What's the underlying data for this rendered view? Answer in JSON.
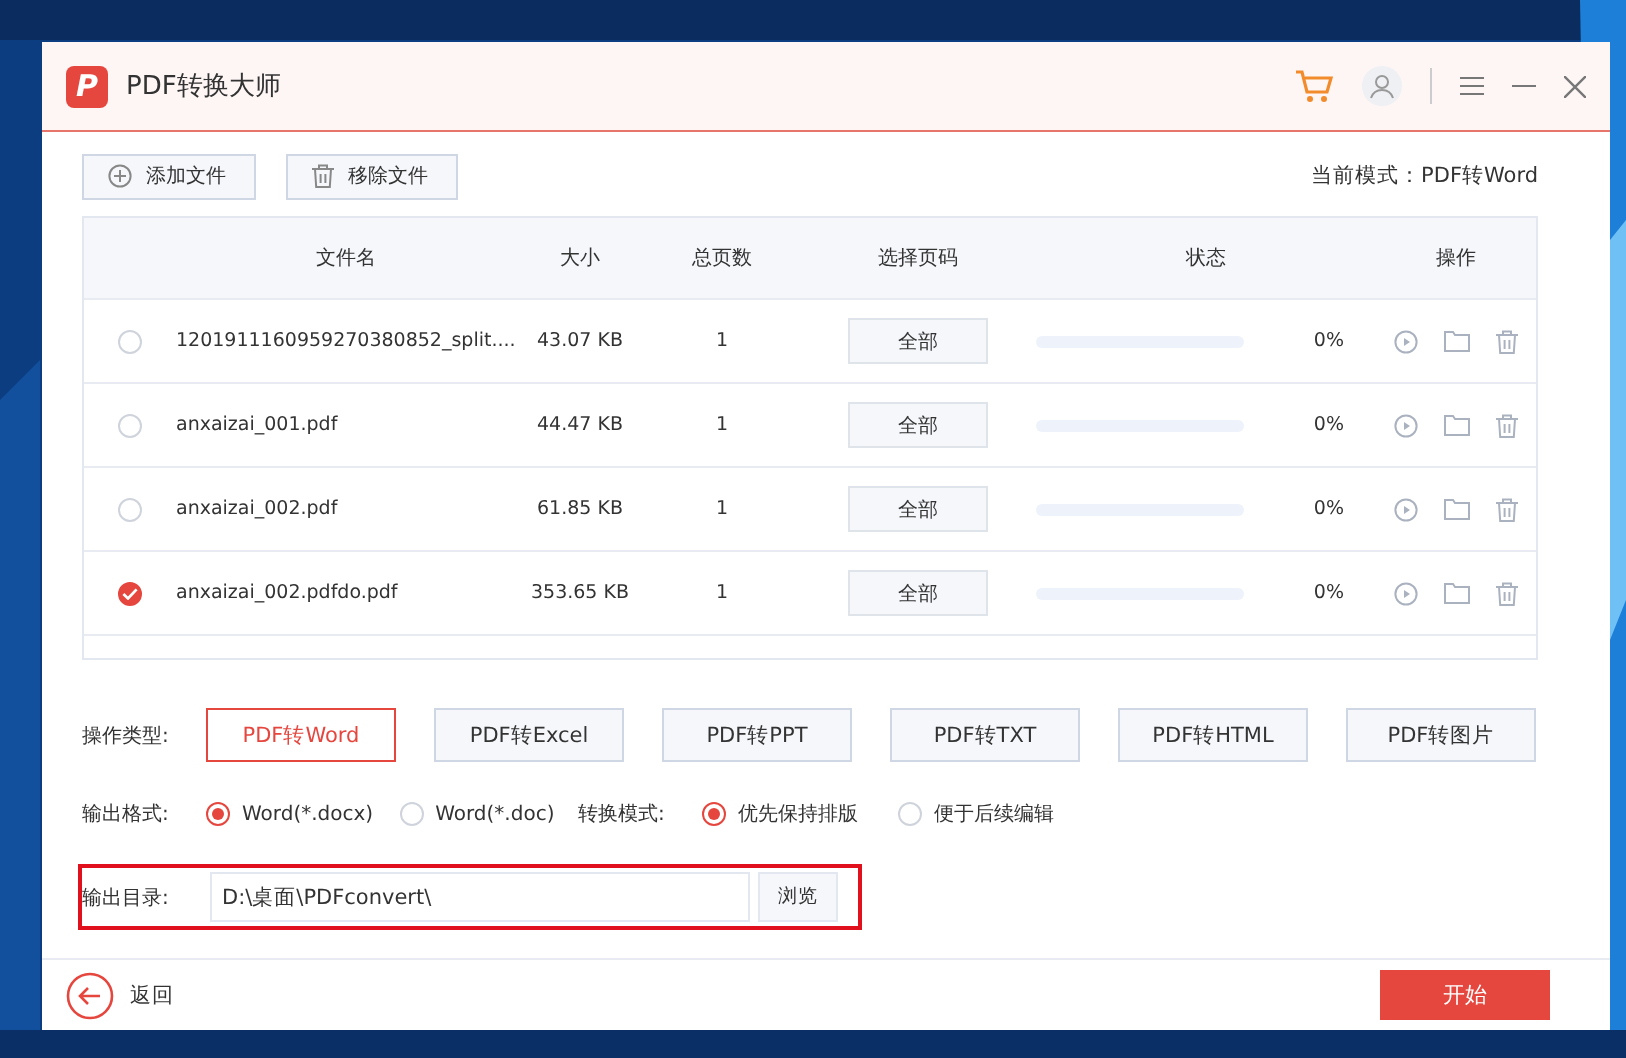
{
  "window": {
    "title": "PDF转换大师",
    "logo": "P"
  },
  "toolbar": {
    "buttons": [
      {
        "kind": "add",
        "label": "添加文件"
      },
      {
        "kind": "remove",
        "label": "移除文件"
      }
    ],
    "mode": "当前模式：PDF转Word"
  },
  "table": {
    "columns": [
      "文件名",
      "大小",
      "总页数",
      "选择页码",
      "状态",
      "操作"
    ],
    "rows": [
      {
        "checked": false,
        "name": "1201911160959270380852_split....",
        "size": "43.07 KB",
        "pages": "1",
        "range": "全部",
        "level": 0,
        "progress": "0%"
      },
      {
        "checked": false,
        "name": "anxaizai_001.pdf",
        "size": "44.47 KB",
        "pages": "1",
        "range": "全部",
        "level": 0,
        "progress": "0%"
      },
      {
        "checked": false,
        "name": "anxaizai_002.pdf",
        "size": "61.85 KB",
        "pages": "1",
        "range": "全部",
        "level": 0,
        "progress": "0%"
      },
      {
        "checked": true,
        "name": "anxaizai_002.pdfdo.pdf",
        "size": "353.65 KB",
        "pages": "1",
        "range": "全部",
        "level": 0,
        "progress": "0%"
      }
    ]
  },
  "operation": {
    "label": "操作类型:",
    "types": [
      {
        "label": "PDF转Word",
        "selected": true
      },
      {
        "label": "PDF转Excel",
        "selected": false
      },
      {
        "label": "PDF转PPT",
        "selected": false
      },
      {
        "label": "PDF转TXT",
        "selected": false
      },
      {
        "label": "PDF转HTML",
        "selected": false
      },
      {
        "label": "PDF转图片",
        "selected": false
      }
    ]
  },
  "format": {
    "label": "输出格式:",
    "options": [
      {
        "label": "Word(*.docx)",
        "selected": true
      },
      {
        "label": "Word(*.doc)",
        "selected": false
      }
    ]
  },
  "convert_mode": {
    "label": "转换模式:",
    "options": [
      {
        "label": "优先保持排版",
        "selected": true
      },
      {
        "label": "便于后续编辑",
        "selected": false
      }
    ]
  },
  "output": {
    "label": "输出目录:",
    "value": "D:\\桌面\\PDFconvert\\",
    "browse": "浏览"
  },
  "footer": {
    "back": "返回",
    "start": "开始"
  }
}
